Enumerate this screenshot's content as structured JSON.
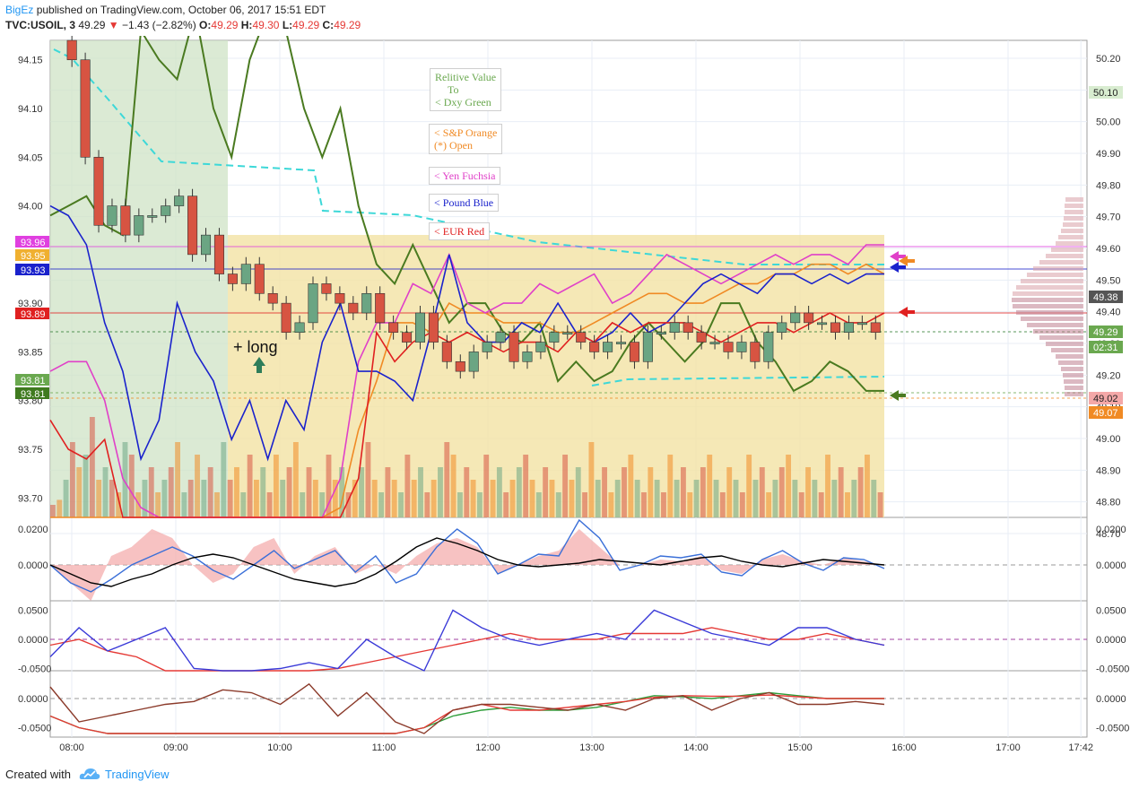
{
  "header": {
    "author": "BigEz",
    "published": "published on TradingView.com, October 06, 2017 15:51 EDT",
    "symbol": "TVC:USOIL, 3",
    "last": "49.29",
    "change": "−1.43 (−2.82%)",
    "o_label": "O:",
    "o_val": "49.29",
    "h_label": "H:",
    "h_val": "49.30",
    "l_label": "L:",
    "l_val": "49.29",
    "c_label": "C:",
    "c_val": "49.29"
  },
  "legend": {
    "dxy": [
      "Relitive Value",
      "To",
      "< Dxy Green"
    ],
    "spx": [
      "< S&P Orange",
      "(*) Open"
    ],
    "yen": "< Yen Fuchsia",
    "gbp": "< Pound Blue",
    "eur": "< EUR Red"
  },
  "annotations": {
    "long": "+ long"
  },
  "footer": {
    "created": "Created with",
    "brand": "TradingView"
  },
  "colors": {
    "up": "#6ba583",
    "down": "#d75442",
    "dxy": "#4a7a20",
    "spx": "#f08a24",
    "yen": "#e040c8",
    "gbp": "#1a22cc",
    "eur": "#e02020",
    "cyan": "#3dd8d8",
    "fill_green": "#cfe3c6",
    "fill_yellow": "#f3e2a4"
  },
  "chart_data": [
    {
      "type": "line",
      "title": "TVC:USOIL, 3",
      "x_ticks": [
        "08:00",
        "09:00",
        "10:00",
        "11:00",
        "12:00",
        "13:00",
        "14:00",
        "15:00",
        "16:00",
        "17:00",
        "17:42"
      ],
      "y_left_ticks": [
        93.7,
        93.75,
        93.8,
        93.85,
        93.9,
        93.95,
        94.0,
        94.05,
        94.1,
        94.15
      ],
      "y_left_tick_labels": [
        "93.70",
        "93.75",
        "93.80",
        "93.85",
        "93.90",
        "93.95",
        "94.00",
        "94.05",
        "94.10",
        "94.15"
      ],
      "y_right_ticks": [
        48.7,
        48.8,
        48.9,
        49.0,
        49.1,
        49.2,
        49.3,
        49.4,
        49.5,
        49.6,
        49.7,
        49.8,
        49.9,
        50.0,
        50.1,
        50.2
      ],
      "y_right_tick_labels": [
        "48.70",
        "48.80",
        "48.90",
        "49.00",
        "49.10",
        "49.20",
        "49.30",
        "49.40",
        "49.50",
        "49.60",
        "49.70",
        "49.80",
        "49.90",
        "50.00",
        "50.10",
        "50.20"
      ],
      "left_badges": [
        {
          "label": "93.96",
          "color": "#e040e0"
        },
        {
          "label": "93.95",
          "color": "#f0b030"
        },
        {
          "label": "93.93",
          "color": "#1a22cc"
        },
        {
          "label": "93.89",
          "color": "#e02020"
        },
        {
          "label": "93.81",
          "color": "#6aa84f"
        },
        {
          "label": "93.81",
          "color": "#3f7a1f"
        }
      ],
      "right_badges": [
        {
          "label": "50.10",
          "color": "#d8ecd0",
          "text": "#222"
        },
        {
          "label": "49.38",
          "color": "#555555",
          "text": "#fff"
        },
        {
          "label": "49.29",
          "color": "#6aa84f",
          "text": "#fff"
        },
        {
          "label": "02:31",
          "color": "#6aa84f",
          "text": "#fff"
        },
        {
          "label": "49.02",
          "color": "#f4a8a8",
          "text": "#222"
        },
        {
          "label": "49.07",
          "color": "#f08a24",
          "text": "#fff"
        }
      ],
      "series": [
        {
          "name": "Dxy Green",
          "y": [
            93.99,
            94.0,
            94.01,
            93.98,
            93.97,
            94.18,
            94.15,
            94.13,
            94.2,
            94.1,
            94.05,
            94.15,
            94.2,
            94.18,
            94.1,
            94.05,
            94.1,
            94.0,
            93.94,
            93.92,
            93.96,
            93.92,
            93.88,
            93.9,
            93.9,
            93.87,
            93.86,
            93.88,
            93.82,
            93.84,
            93.82,
            93.83,
            93.86,
            93.88,
            93.86,
            93.84,
            93.86,
            93.9,
            93.9,
            93.86,
            93.84,
            93.81,
            93.82,
            93.84,
            93.83,
            93.81,
            93.81
          ]
        },
        {
          "name": "S&P Orange",
          "y": [
            93.68,
            93.68,
            93.67,
            93.66,
            93.66,
            93.66,
            93.66,
            93.66,
            93.66,
            93.66,
            93.66,
            93.66,
            93.66,
            93.66,
            93.66,
            93.66,
            93.69,
            93.77,
            93.82,
            93.88,
            93.88,
            93.87,
            93.9,
            93.89,
            93.89,
            93.88,
            93.88,
            93.88,
            93.87,
            93.87,
            93.88,
            93.89,
            93.9,
            93.91,
            93.91,
            93.9,
            93.9,
            93.91,
            93.92,
            93.92,
            93.93,
            93.93,
            93.94,
            93.94,
            93.93,
            93.94,
            93.93
          ]
        },
        {
          "name": "Yen Fuchsia",
          "y": [
            93.83,
            93.84,
            93.84,
            93.8,
            93.72,
            93.69,
            93.68,
            93.67,
            93.66,
            93.66,
            93.66,
            93.66,
            93.66,
            93.66,
            93.66,
            93.66,
            93.72,
            93.84,
            93.88,
            93.88,
            93.92,
            93.91,
            93.95,
            93.9,
            93.89,
            93.9,
            93.9,
            93.92,
            93.91,
            93.92,
            93.93,
            93.9,
            93.91,
            93.93,
            93.95,
            93.94,
            93.93,
            93.92,
            93.93,
            93.94,
            93.95,
            93.94,
            93.95,
            93.95,
            93.94,
            93.96,
            93.96
          ]
        },
        {
          "name": "Pound Blue",
          "y": [
            94.0,
            93.99,
            93.96,
            93.88,
            93.83,
            93.74,
            93.78,
            93.9,
            93.85,
            93.82,
            93.76,
            93.8,
            93.74,
            93.8,
            93.77,
            93.86,
            93.9,
            93.83,
            93.83,
            93.82,
            93.8,
            93.87,
            93.95,
            93.88,
            93.86,
            93.86,
            93.88,
            93.87,
            93.9,
            93.87,
            93.86,
            93.87,
            93.89,
            93.87,
            93.88,
            93.9,
            93.92,
            93.93,
            93.92,
            93.91,
            93.93,
            93.93,
            93.92,
            93.93,
            93.92,
            93.93,
            93.93
          ]
        },
        {
          "name": "EUR Red",
          "y": [
            93.78,
            93.75,
            93.74,
            93.76,
            93.68,
            93.66,
            93.66,
            93.66,
            93.66,
            93.66,
            93.66,
            93.66,
            93.66,
            93.66,
            93.66,
            93.66,
            93.66,
            93.72,
            93.87,
            93.84,
            93.86,
            93.87,
            93.86,
            93.87,
            93.86,
            93.85,
            93.86,
            93.86,
            93.85,
            93.87,
            93.86,
            93.88,
            93.87,
            93.88,
            93.88,
            93.88,
            93.87,
            93.86,
            93.87,
            93.88,
            93.88,
            93.87,
            93.88,
            93.89,
            93.88,
            93.88,
            93.89
          ]
        }
      ],
      "candles_close": [
        94.17,
        94.15,
        94.05,
        93.98,
        94.0,
        93.97,
        93.99,
        93.99,
        94.0,
        94.01,
        93.95,
        93.97,
        93.93,
        93.92,
        93.94,
        93.91,
        93.9,
        93.87,
        93.88,
        93.92,
        93.91,
        93.9,
        93.89,
        93.91,
        93.88,
        93.87,
        93.86,
        93.89,
        93.86,
        93.84,
        93.83,
        93.85,
        93.86,
        93.87,
        93.84,
        93.85,
        93.86,
        93.87,
        93.87,
        93.86,
        93.85,
        93.86,
        93.86,
        93.84,
        93.87,
        93.87,
        93.88,
        93.87,
        93.86,
        93.86,
        93.85,
        93.86,
        93.84,
        93.87,
        93.88,
        93.89,
        93.88,
        93.88,
        93.87,
        93.88,
        93.88,
        93.87
      ]
    },
    {
      "type": "area",
      "y_ticks": [
        0.02,
        0.0
      ],
      "y_tick_labels": [
        "0.0200",
        "0.0000"
      ],
      "series": [
        {
          "y": [
            0.0,
            -0.01,
            -0.02,
            0.005,
            0.01,
            0.02,
            0.015,
            0.0,
            -0.01,
            -0.005,
            0.01,
            0.015,
            -0.005,
            0.005,
            0.01,
            -0.005,
            0.0,
            -0.005,
            0.005,
            0.012,
            0.015,
            0.01,
            -0.005,
            0.0,
            0.005,
            0.008,
            0.02,
            0.01,
            0.0,
            0.0,
            0.003,
            0.002,
            0.005,
            -0.003,
            -0.005,
            0.003,
            0.006,
            0.002,
            0.0,
            0.004,
            0.002,
            0.0
          ]
        },
        {
          "y": [
            0.0,
            -0.01,
            -0.015,
            -0.008,
            0.0,
            0.005,
            0.01,
            0.005,
            -0.003,
            -0.008,
            0.0,
            0.008,
            -0.002,
            0.003,
            0.008,
            -0.004,
            0.005,
            -0.01,
            -0.005,
            0.01,
            0.02,
            0.012,
            -0.005,
            0.0,
            0.006,
            0.005,
            0.025,
            0.015,
            -0.003,
            0.0,
            0.005,
            0.004,
            0.006,
            -0.004,
            -0.006,
            0.003,
            0.008,
            0.001,
            -0.003,
            0.004,
            0.003,
            -0.002
          ]
        },
        {
          "y": [
            0.0,
            -0.005,
            -0.01,
            -0.012,
            -0.008,
            -0.005,
            0.0,
            0.004,
            0.006,
            0.004,
            0.0,
            -0.004,
            -0.008,
            -0.01,
            -0.012,
            -0.01,
            -0.005,
            0.002,
            0.01,
            0.015,
            0.012,
            0.008,
            0.003,
            0.0,
            -0.001,
            0.0,
            0.001,
            0.003,
            0.002,
            0.001,
            0.0,
            0.002,
            0.004,
            0.005,
            0.002,
            0.0,
            -0.001,
            0.001,
            0.003,
            0.002,
            0.001,
            0.0
          ]
        }
      ]
    },
    {
      "type": "line",
      "y_ticks": [
        0.05,
        0.0,
        -0.05
      ],
      "y_tick_labels": [
        "0.0500",
        "0.0000",
        "-0.0500"
      ],
      "series": [
        {
          "y": [
            -0.01,
            0.0,
            -0.02,
            -0.03,
            -0.06,
            -0.07,
            -0.06,
            -0.07,
            -0.08,
            -0.06,
            -0.05,
            -0.04,
            -0.03,
            -0.02,
            -0.01,
            0.0,
            0.01,
            0.0,
            0.0,
            0.0,
            0.01,
            0.01,
            0.01,
            0.02,
            0.01,
            0.0,
            0.0,
            0.01,
            0.0,
            -0.01
          ]
        },
        {
          "y": [
            -0.03,
            0.02,
            -0.02,
            0.0,
            0.02,
            -0.05,
            -0.06,
            -0.07,
            -0.05,
            -0.04,
            -0.05,
            0.0,
            -0.03,
            -0.06,
            0.05,
            0.02,
            0.0,
            -0.01,
            0.0,
            0.01,
            0.0,
            0.05,
            0.03,
            0.01,
            0.0,
            -0.01,
            0.02,
            0.02,
            0.0,
            -0.01
          ]
        }
      ]
    },
    {
      "type": "line",
      "y_ticks": [
        0.0,
        -0.05
      ],
      "y_tick_labels": [
        "0.0000",
        "-0.0500"
      ],
      "series": [
        {
          "y": [
            -0.03,
            -0.05,
            -0.06,
            -0.06,
            -0.06,
            -0.06,
            -0.06,
            -0.06,
            -0.06,
            -0.06,
            -0.06,
            -0.06,
            -0.06,
            -0.05,
            -0.03,
            -0.02,
            -0.015,
            -0.02,
            -0.02,
            -0.015,
            -0.005,
            0.005,
            0.003,
            0.0,
            0.005,
            0.01,
            0.005,
            0.0,
            0.0,
            0.0
          ]
        },
        {
          "y": [
            -0.03,
            -0.05,
            -0.06,
            -0.06,
            -0.06,
            -0.06,
            -0.06,
            -0.06,
            -0.06,
            -0.06,
            -0.06,
            -0.06,
            -0.06,
            -0.05,
            -0.02,
            -0.01,
            -0.02,
            -0.02,
            -0.015,
            -0.01,
            -0.005,
            0.002,
            0.005,
            0.004,
            0.004,
            0.006,
            0.003,
            0.0,
            0.0,
            0.0
          ]
        },
        {
          "y": [
            0.02,
            -0.04,
            -0.03,
            -0.02,
            -0.01,
            -0.005,
            0.015,
            0.01,
            -0.01,
            0.025,
            -0.03,
            0.01,
            -0.04,
            -0.06,
            -0.02,
            -0.01,
            -0.01,
            -0.015,
            -0.02,
            -0.01,
            -0.02,
            0.0,
            0.005,
            -0.02,
            0.0,
            0.01,
            -0.01,
            -0.01,
            -0.005,
            -0.01
          ]
        }
      ]
    }
  ]
}
